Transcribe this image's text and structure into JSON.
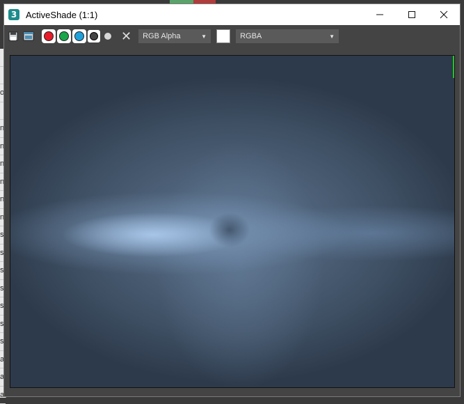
{
  "window": {
    "title": "ActiveShade (1:1)",
    "app_icon_glyph": "3",
    "controls": [
      "minimize",
      "maximize",
      "close"
    ]
  },
  "toolbar": {
    "icons": [
      "save-icon",
      "clone-window-icon"
    ],
    "channels": [
      {
        "name": "red-channel",
        "color": "#e81c2a"
      },
      {
        "name": "green-channel",
        "color": "#1aa64a"
      },
      {
        "name": "blue-channel",
        "color": "#1fa1dc"
      }
    ],
    "channel_dropdown": "RGB Alpha",
    "display_dropdown": "RGBA",
    "swatch_color": "#ffffff"
  },
  "background_rows": [
    "",
    "",
    "o",
    "",
    "n",
    "n",
    "n",
    "n",
    "n",
    "n",
    "s",
    "s",
    "s",
    "s",
    "s",
    "s",
    "s",
    "a",
    "a",
    "a"
  ]
}
